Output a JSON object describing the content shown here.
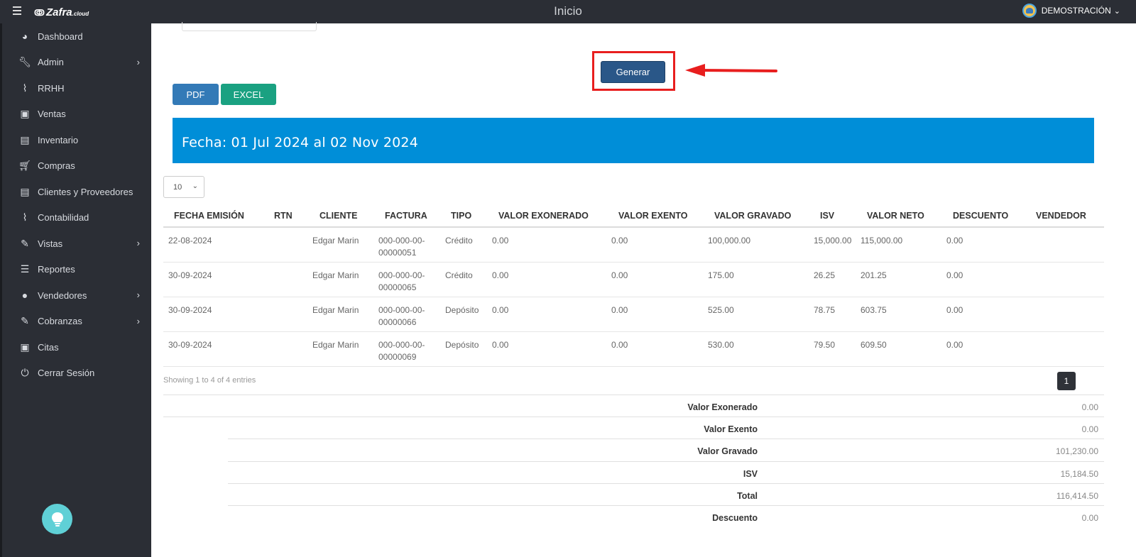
{
  "app": {
    "logo": "Zafra",
    "logo_suffix": ".cloud",
    "page_title": "Inicio",
    "user_name": "DEMOSTRACIÓN"
  },
  "sidebar": {
    "items": [
      {
        "label": "Dashboard",
        "icon": "dashboard-icon",
        "has_submenu": false
      },
      {
        "label": "Admin",
        "icon": "wrench-icon",
        "has_submenu": true
      },
      {
        "label": "RRHH",
        "icon": "paperclip-icon",
        "has_submenu": false
      },
      {
        "label": "Ventas",
        "icon": "money-icon",
        "has_submenu": false
      },
      {
        "label": "Inventario",
        "icon": "book-icon",
        "has_submenu": false
      },
      {
        "label": "Compras",
        "icon": "cart-icon",
        "has_submenu": false
      },
      {
        "label": "Clientes y Proveedores",
        "icon": "book-icon",
        "has_submenu": false
      },
      {
        "label": "Contabilidad",
        "icon": "paperclip-icon",
        "has_submenu": false
      },
      {
        "label": "Vistas",
        "icon": "edit-icon",
        "has_submenu": true
      },
      {
        "label": "Reportes",
        "icon": "list-icon",
        "has_submenu": false
      },
      {
        "label": "Vendedores",
        "icon": "user-icon",
        "has_submenu": true
      },
      {
        "label": "Cobranzas",
        "icon": "edit-icon",
        "has_submenu": true
      },
      {
        "label": "Citas",
        "icon": "money-icon",
        "has_submenu": false
      },
      {
        "label": "Cerrar Sesión",
        "icon": "power-icon",
        "has_submenu": false
      }
    ]
  },
  "actions": {
    "generar": "Generar",
    "pdf": "PDF",
    "excel": "EXCEL"
  },
  "banner": {
    "text": "Fecha: 01 Jul 2024 al 02 Nov 2024"
  },
  "table": {
    "page_length": "10",
    "columns": [
      "FECHA EMISIÓN",
      "RTN",
      "CLIENTE",
      "FACTURA",
      "TIPO",
      "VALOR EXONERADO",
      "VALOR EXENTO",
      "VALOR GRAVADO",
      "ISV",
      "VALOR NETO",
      "DESCUENTO",
      "VENDEDOR"
    ],
    "rows": [
      [
        "22-08-2024",
        "",
        "Edgar Marin",
        "000-000-00-00000051",
        "Crédito",
        "0.00",
        "0.00",
        "100,000.00",
        "15,000.00",
        "115,000.00",
        "0.00",
        ""
      ],
      [
        "30-09-2024",
        "",
        "Edgar Marin",
        "000-000-00-00000065",
        "Crédito",
        "0.00",
        "0.00",
        "175.00",
        "26.25",
        "201.25",
        "0.00",
        ""
      ],
      [
        "30-09-2024",
        "",
        "Edgar Marin",
        "000-000-00-00000066",
        "Depósito",
        "0.00",
        "0.00",
        "525.00",
        "78.75",
        "603.75",
        "0.00",
        ""
      ],
      [
        "30-09-2024",
        "",
        "Edgar Marin",
        "000-000-00-00000069",
        "Depósito",
        "0.00",
        "0.00",
        "530.00",
        "79.50",
        "609.50",
        "0.00",
        ""
      ]
    ],
    "showing": "Showing 1 to 4 of 4 entries",
    "current_page": "1"
  },
  "totals": [
    {
      "label": "Valor Exonerado",
      "value": "0.00"
    },
    {
      "label": "Valor Exento",
      "value": "0.00"
    },
    {
      "label": "Valor Gravado",
      "value": "101,230.00"
    },
    {
      "label": "ISV",
      "value": "15,184.50"
    },
    {
      "label": "Total",
      "value": "116,414.50"
    },
    {
      "label": "Descuento",
      "value": "0.00"
    }
  ],
  "colors": {
    "sidebar": "#2b2e35",
    "banner": "#008ed8",
    "generar": "#2a5788",
    "pdf": "#337ab7",
    "excel": "#1aa181",
    "highlight": "#e81e1e"
  }
}
